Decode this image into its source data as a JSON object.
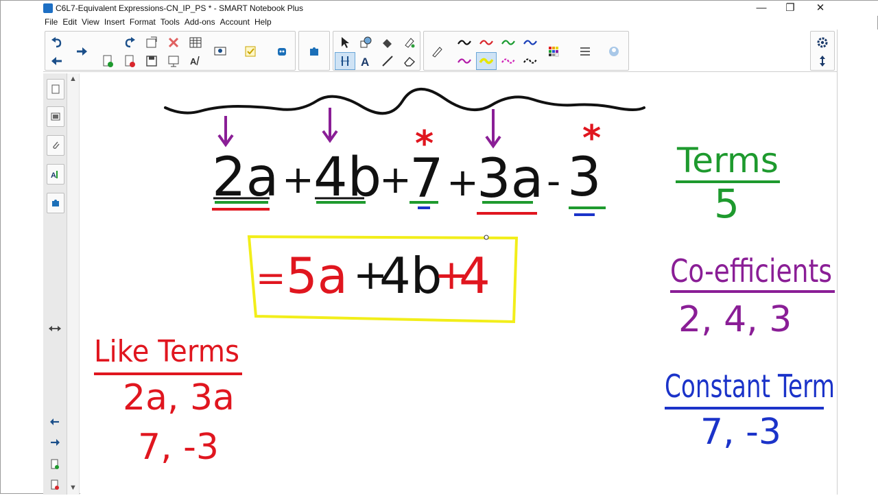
{
  "window": {
    "title": "C6L7-Equivalent Expressions-CN_IP_PS * - SMART Notebook Plus",
    "minimize": "—",
    "restore": "❐",
    "close": "✕"
  },
  "menu": [
    "File",
    "Edit",
    "View",
    "Insert",
    "Format",
    "Tools",
    "Add-ons",
    "Account",
    "Help"
  ],
  "toolbar": {
    "icons": [
      "undo-icon",
      "redo-icon",
      "back-icon",
      "forward-icon",
      "add-page-icon",
      "delete-page-icon",
      "delete-icon",
      "table-icon",
      "open-icon",
      "save-icon",
      "screen-shade-icon",
      "handwriting-icon",
      "document-camera-icon",
      "activity-builder-icon",
      "monster-icon",
      "addons-icon",
      "select-icon",
      "shapes-icon",
      "fill-icon",
      "paint-icon",
      "measure-icon",
      "text-icon",
      "line-icon",
      "eraser-icon",
      "pen-icon",
      "color-palette-icon",
      "properties-icon",
      "more-icon",
      "settings-icon",
      "toggle-toolbar-icon"
    ],
    "pen_colors": [
      "#111111",
      "#d9262c",
      "#1a9b30",
      "#1a3fb8",
      "#b21aa8",
      "#e6e600",
      "#d01fb7",
      "#111111"
    ]
  },
  "sidebar": {
    "icons": [
      "page-sorter-icon",
      "gallery-icon",
      "attachments-icon",
      "properties-icon",
      "addons-icon",
      "resize-icon",
      "previous-page-icon",
      "next-page-icon",
      "add-page-icon",
      "delete-page-icon"
    ]
  },
  "board": {
    "expression": {
      "t1": "2a",
      "op1": "+",
      "t2": "4b",
      "op2": "+",
      "t3": "7",
      "op3": "+",
      "t4": "3a",
      "op4": "-",
      "t5": "3"
    },
    "star": "*",
    "arrow": "↓",
    "result": {
      "eq": "=",
      "a": "5a",
      "p1": "+",
      "b": "4b",
      "p2": "+",
      "c": "4"
    },
    "like_terms": {
      "heading": "Like Terms",
      "line1": "2a, 3a",
      "line2": "7, -3"
    },
    "terms": {
      "heading": "Terms",
      "value": "5"
    },
    "coefficients": {
      "heading": "Co-efficients",
      "value": "2, 4, 3"
    },
    "constant_term": {
      "heading": "Constant Term",
      "value": "7, -3"
    }
  },
  "colors": {
    "black": "#111111",
    "red": "#e0161f",
    "green": "#1e9a2e",
    "blue": "#1b33c9",
    "purple": "#8a1e96",
    "yellow": "#f2ee1a"
  }
}
